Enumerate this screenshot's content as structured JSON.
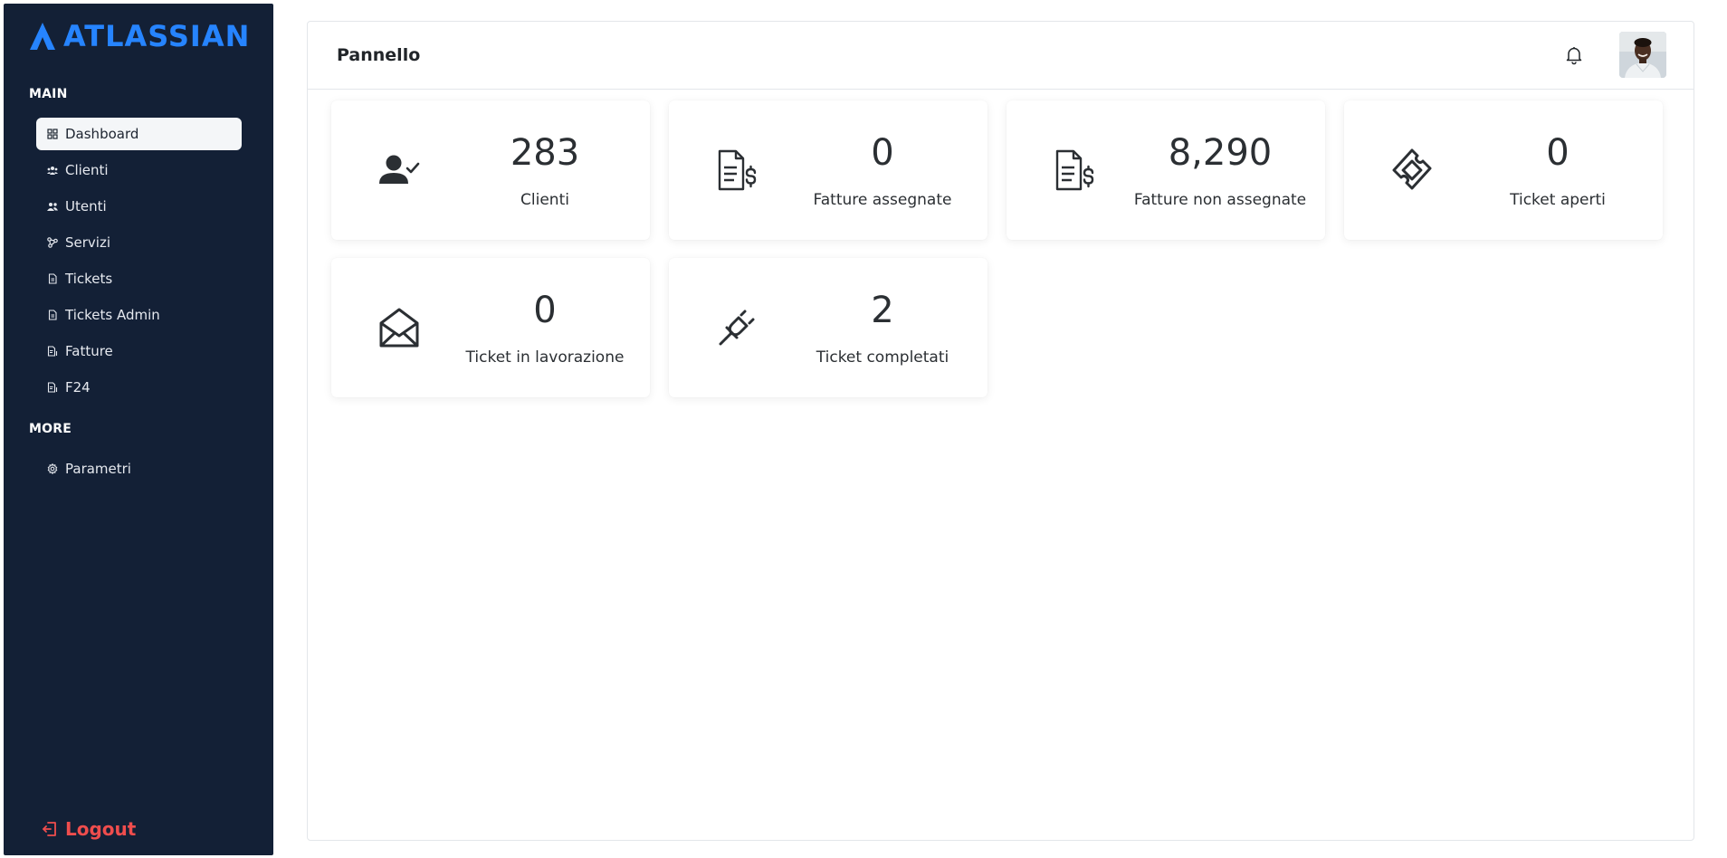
{
  "brand": {
    "name": "ATLASSIAN",
    "color": "#2684ff"
  },
  "sidebar": {
    "sections": [
      {
        "title": "MAIN"
      },
      {
        "title": "MORE"
      }
    ],
    "items": [
      {
        "label": "Dashboard",
        "icon": "grid-icon",
        "active": true
      },
      {
        "label": "Clienti",
        "icon": "users-icon"
      },
      {
        "label": "Utenti",
        "icon": "user-group-icon"
      },
      {
        "label": "Servizi",
        "icon": "nodes-icon"
      },
      {
        "label": "Tickets",
        "icon": "file-icon"
      },
      {
        "label": "Tickets Admin",
        "icon": "file-icon"
      },
      {
        "label": "Fatture",
        "icon": "invoice-icon"
      },
      {
        "label": "F24",
        "icon": "invoice-icon"
      }
    ],
    "more_items": [
      {
        "label": "Parametri",
        "icon": "gear-icon"
      }
    ],
    "logout_label": "Logout",
    "logout_color": "#ef4d4d",
    "background": "#132036"
  },
  "header": {
    "title": "Pannello"
  },
  "cards": [
    {
      "value": "283",
      "label": "Clienti",
      "icon": "user-check-icon"
    },
    {
      "value": "0",
      "label": "Fatture assegnate",
      "icon": "invoice-dollar-icon"
    },
    {
      "value": "8,290",
      "label": "Fatture non assegnate",
      "icon": "invoice-dollar-icon"
    },
    {
      "value": "0",
      "label": "Ticket aperti",
      "icon": "ticket-icon"
    },
    {
      "value": "0",
      "label": "Ticket in lavorazione",
      "icon": "envelope-open-icon"
    },
    {
      "value": "2",
      "label": "Ticket completati",
      "icon": "plug-icon"
    }
  ]
}
